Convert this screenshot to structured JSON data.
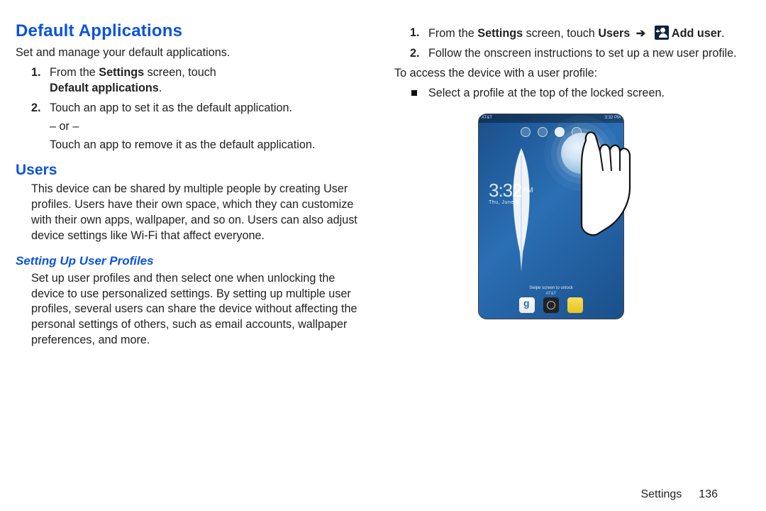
{
  "left": {
    "h1": "Default Applications",
    "intro": "Set and manage your default applications.",
    "steps": [
      {
        "num": "1.",
        "prefix": "From the ",
        "bold1": "Settings",
        "mid": " screen, touch ",
        "bold2": "Default applications",
        "suffix": "."
      },
      {
        "num": "2.",
        "text": "Touch an app to set it as the default application."
      }
    ],
    "or": "– or –",
    "after_or": "Touch an app to remove it as the default application.",
    "h2": "Users",
    "users_body": "This device can be shared by multiple people by creating User profiles. Users have their own space, which they can customize with their own apps, wallpaper, and so on. Users can also adjust device settings like Wi-Fi that affect everyone.",
    "h3": "Setting Up User Profiles",
    "profiles_body": "Set up user profiles and then select one when unlocking the device to use personalized settings. By setting up multiple user profiles, several users can share the device without affecting the personal settings of others, such as email accounts, wallpaper preferences, and more."
  },
  "right": {
    "step1": {
      "num": "1.",
      "prefix": "From the ",
      "bold1": "Settings",
      "mid1": " screen, touch ",
      "bold2": "Users",
      "arrow": " ➔ ",
      "bold3": "Add user",
      "suffix": "."
    },
    "step2": {
      "num": "2.",
      "text": "Follow the onscreen instructions to set up a new user profile."
    },
    "access": "To access the device with a user profile:",
    "bullet": "Select a profile at the top of the locked screen.",
    "device": {
      "status_left": "AT&T",
      "status_right": "3:32 PM",
      "time": "3:32",
      "ampm": "PM",
      "date": "Thu, June 5",
      "unlock": "Swipe screen to unlock",
      "carrier": "AT&T"
    }
  },
  "footer": {
    "section": "Settings",
    "page": "136"
  }
}
